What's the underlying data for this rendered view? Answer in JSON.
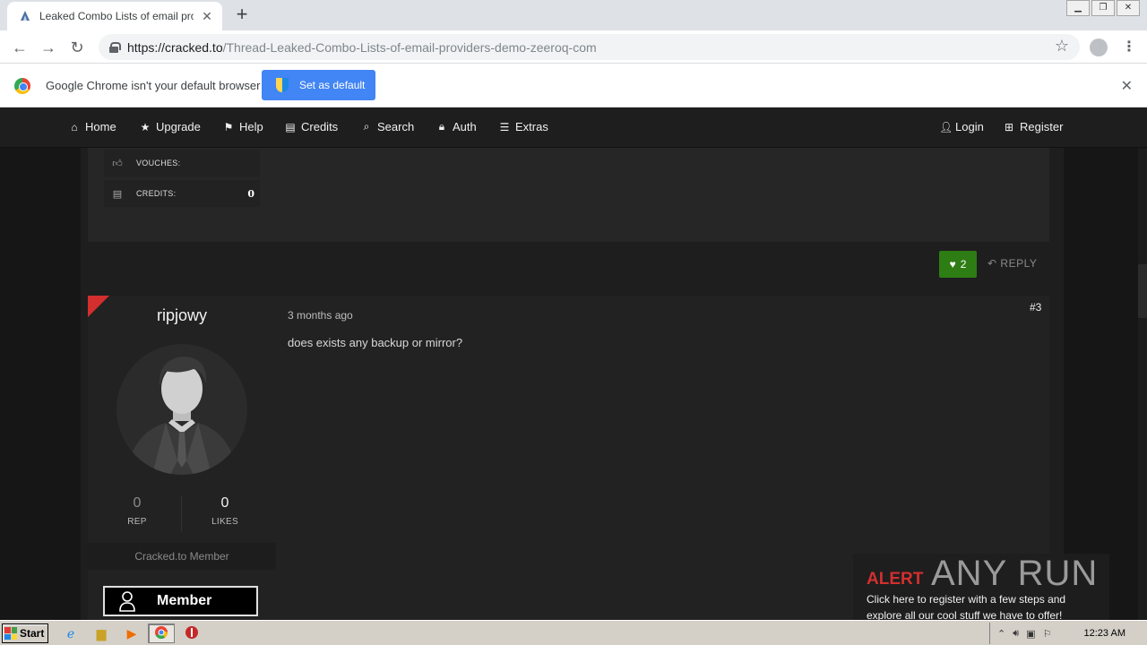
{
  "browser": {
    "tab_title": "Leaked Combo Lists of email providers",
    "url_host": "https://cracked.to",
    "url_path": "/Thread-Leaked-Combo-Lists-of-email-providers-demo-zeeroq-com",
    "infobar_text": "Google Chrome isn't your default browser",
    "set_default_label": "Set as default"
  },
  "nav": {
    "left": [
      {
        "icon": "home-icon",
        "label": "Home"
      },
      {
        "icon": "star-icon",
        "label": "Upgrade"
      },
      {
        "icon": "flag-icon",
        "label": "Help"
      },
      {
        "icon": "money-icon",
        "label": "Credits"
      },
      {
        "icon": "search-icon",
        "label": "Search"
      },
      {
        "icon": "lock-icon",
        "label": "Auth"
      },
      {
        "icon": "bars-icon",
        "label": "Extras"
      }
    ],
    "right": [
      {
        "icon": "user-icon",
        "label": "Login"
      },
      {
        "icon": "plus-square-icon",
        "label": "Register"
      }
    ]
  },
  "prev_post": {
    "vouches_label": "VOUCHES:",
    "vouches_value": "",
    "credits_label": "CREDITS:",
    "credits_value": "0",
    "like_count": "2",
    "reply_label": "REPLY"
  },
  "post": {
    "username": "ripjowy",
    "date": "3 months ago",
    "number": "#3",
    "text": "does exists any backup or mirror?",
    "rep_value": "0",
    "rep_label": "REP",
    "likes_value": "0",
    "likes_label": "LIKES",
    "user_title": "Cracked.to Member",
    "badge_label": "Member"
  },
  "anyrun": {
    "alert": "ALERT",
    "brand": "ANY RUN",
    "message": "Click here to register with a few steps and explore all our cool stuff we have to offer!"
  },
  "taskbar": {
    "start_label": "Start",
    "clock": "12:23 AM"
  },
  "colors": {
    "accent_blue": "#4285f4",
    "like_green": "#2e7d14",
    "rank_red": "#d32f2f",
    "nav_bg": "#1e1e1e"
  }
}
